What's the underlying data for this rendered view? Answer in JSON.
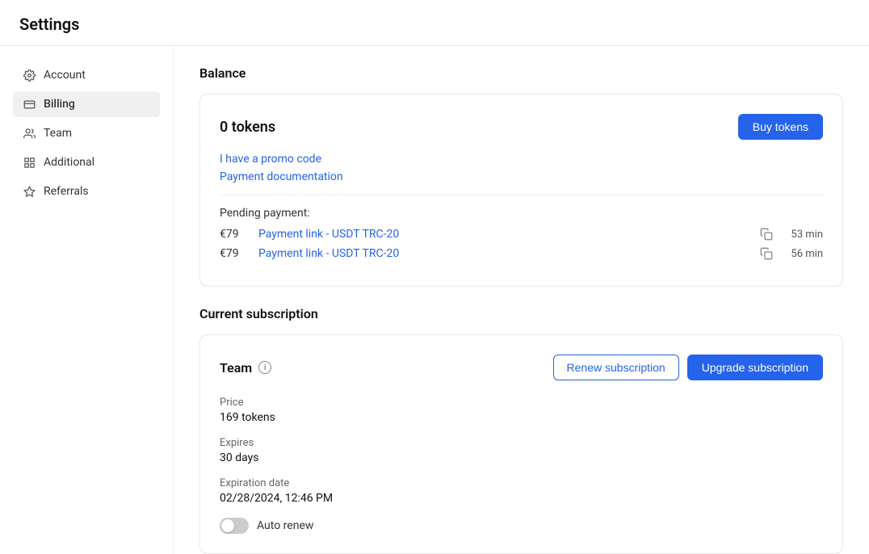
{
  "page": {
    "title": "Settings"
  },
  "sidebar": {
    "items": [
      {
        "id": "account",
        "label": "Account",
        "icon": "gear"
      },
      {
        "id": "billing",
        "label": "Billing",
        "icon": "billing",
        "active": true
      },
      {
        "id": "team",
        "label": "Team",
        "icon": "team"
      },
      {
        "id": "additional",
        "label": "Additional",
        "icon": "additional"
      },
      {
        "id": "referrals",
        "label": "Referrals",
        "icon": "star"
      }
    ]
  },
  "balance": {
    "section_title": "Balance",
    "amount": "0 tokens",
    "buy_button": "Buy tokens",
    "promo_link": "I have a promo code",
    "docs_link": "Payment documentation",
    "pending_label": "Pending payment:",
    "payments": [
      {
        "amount": "€79",
        "link": "Payment link - USDT TRC-20",
        "time": "53 min"
      },
      {
        "amount": "€79",
        "link": "Payment link - USDT TRC-20",
        "time": "56 min"
      }
    ]
  },
  "subscription": {
    "section_title": "Current subscription",
    "plan_name": "Team",
    "renew_button": "Renew subscription",
    "upgrade_button": "Upgrade subscription",
    "price_label": "Price",
    "price_value": "169 tokens",
    "expires_label": "Expires",
    "expires_value": "30 days",
    "expiration_date_label": "Expiration date",
    "expiration_date_value": "02/28/2024, 12:46 PM",
    "auto_renew_label": "Auto renew",
    "auto_renew": false
  }
}
